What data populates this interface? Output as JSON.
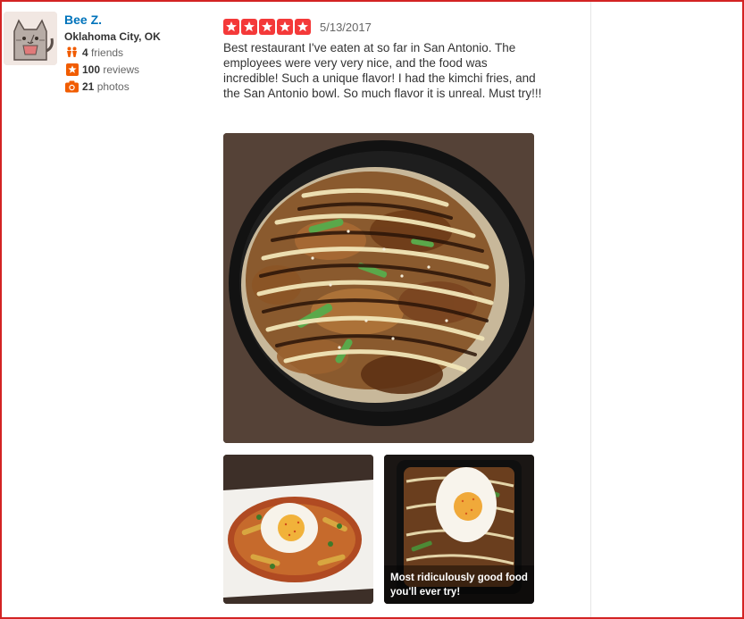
{
  "user": {
    "name": "Bee Z.",
    "location": "Oklahoma City, OK",
    "friends_count": "4",
    "friends_label": "friends",
    "reviews_count": "100",
    "reviews_label": "reviews",
    "photos_count": "21",
    "photos_label": "photos"
  },
  "review": {
    "rating": 5,
    "date": "5/13/2017",
    "text": "Best restaurant I've eaten at so far in San Antonio. The employees were very very nice, and the food was incredible! Such a unique flavor! I had the kimchi fries, and the San Antonio bowl. So much flavor it is unreal. Must try!!!"
  },
  "photos": {
    "thumb2_caption": "Most ridiculously good food you'll ever try!"
  },
  "colors": {
    "star": "#f43939",
    "link": "#0073bb",
    "border": "#d32323",
    "icon_orange": "#f15c00"
  }
}
